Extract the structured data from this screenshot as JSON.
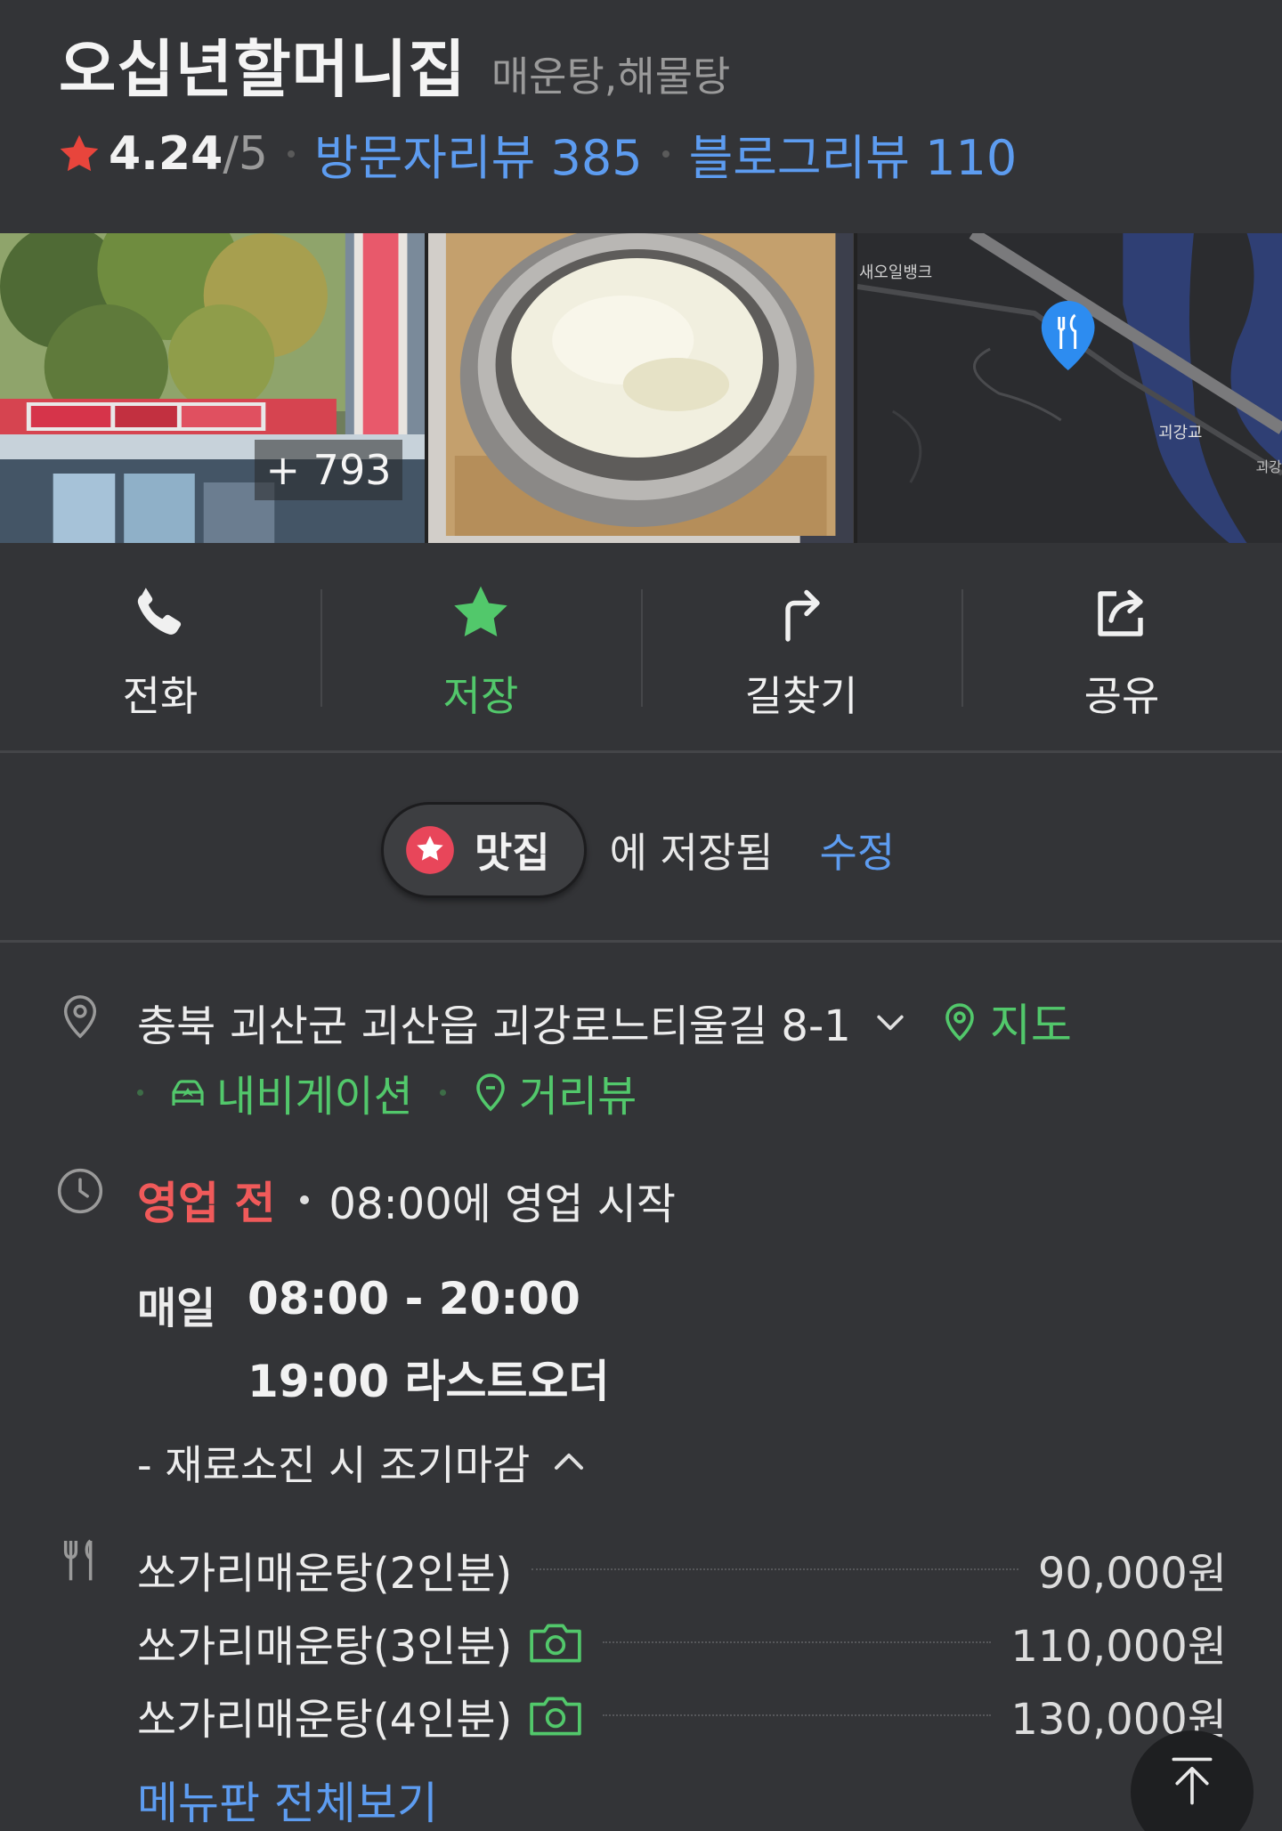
{
  "place": {
    "name": "오십년할머니집",
    "category": "매운탕,해물탕",
    "rating": "4.24",
    "rating_max": "/5",
    "visitor_reviews": "방문자리뷰 385",
    "blog_reviews": "블로그리뷰 110"
  },
  "photos": {
    "count_label": "+ 793",
    "map_labels": [
      "새오일뱅크",
      "괴강교",
      "괴강"
    ]
  },
  "actions": [
    {
      "label": "전화",
      "icon": "phone-icon"
    },
    {
      "label": "저장",
      "icon": "star-icon",
      "active": true
    },
    {
      "label": "길찾기",
      "icon": "directions-icon"
    },
    {
      "label": "공유",
      "icon": "share-icon"
    }
  ],
  "saved": {
    "chip_label": "맛집",
    "text": "에 저장됨",
    "edit": "수정"
  },
  "address": {
    "text": "충북 괴산군 괴산읍 괴강로느티울길 8-1",
    "map_link": "지도",
    "navigation": "내비게이션",
    "street_view": "거리뷰"
  },
  "hours": {
    "status": "영업 전",
    "open_info": "08:00에 영업 시작",
    "day": "매일",
    "time": "08:00 - 20:00",
    "last_order": "19:00 라스트오더",
    "note": "- 재료소진 시 조기마감"
  },
  "menu": {
    "items": [
      {
        "name": "쏘가리매운탕(2인분)",
        "price": "90,000원",
        "has_photo": false
      },
      {
        "name": "쏘가리매운탕(3인분)",
        "price": "110,000원",
        "has_photo": true
      },
      {
        "name": "쏘가리매운탕(4인분)",
        "price": "130,000원",
        "has_photo": true
      }
    ],
    "more": "메뉴판 전체보기"
  },
  "colors": {
    "background": "#333437",
    "accent_green": "#52c86b",
    "accent_blue": "#5d9cf0",
    "status_red": "#f05a5a",
    "star_red": "#e8453c"
  }
}
